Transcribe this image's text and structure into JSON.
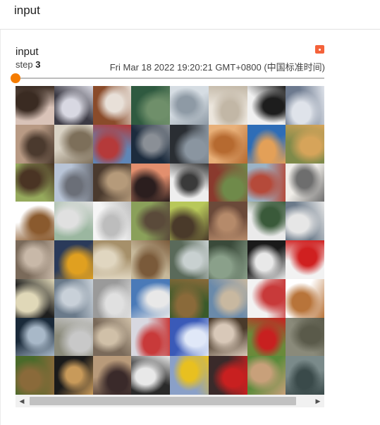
{
  "section": {
    "title": "input"
  },
  "card": {
    "title": "input",
    "step_label": "step",
    "step_value": "3",
    "timestamp": "Fri Mar 18 2022 19:20:21 GMT+0800 (中国标准时间)",
    "slider_fraction": 0.0,
    "accent_color": "#f57c00",
    "menu_icon_color": "#f4623a"
  },
  "image_grid": {
    "rows": 8,
    "cols": 8,
    "cells": [
      {
        "subject": "ship",
        "colors": [
          "#d9c3b8",
          "#3a2b22"
        ]
      },
      {
        "subject": "automobile",
        "colors": [
          "#3c3a44",
          "#d8d8e2"
        ]
      },
      {
        "subject": "horse",
        "colors": [
          "#8a4b2a",
          "#e8e0d8"
        ]
      },
      {
        "subject": "bird",
        "colors": [
          "#2f5a40",
          "#6f8f6a"
        ]
      },
      {
        "subject": "ship",
        "colors": [
          "#d6dde3",
          "#8e9aa5"
        ]
      },
      {
        "subject": "ship",
        "colors": [
          "#ebe5dc",
          "#c2b7a6"
        ]
      },
      {
        "subject": "horse",
        "colors": [
          "#f0f0f0",
          "#1d1d1d"
        ]
      },
      {
        "subject": "ship",
        "colors": [
          "#6d7a8f",
          "#dfe3ea"
        ]
      },
      {
        "subject": "dog",
        "colors": [
          "#b89a84",
          "#4b3a2e"
        ]
      },
      {
        "subject": "truck",
        "colors": [
          "#d9d2c4",
          "#7d6f5a"
        ]
      },
      {
        "subject": "ship",
        "colors": [
          "#5f86b6",
          "#b53a3a"
        ]
      },
      {
        "subject": "horse",
        "colors": [
          "#1c2b3d",
          "#8a8f96"
        ]
      },
      {
        "subject": "automobile",
        "colors": [
          "#2a2e33",
          "#8a95a0"
        ]
      },
      {
        "subject": "cat",
        "colors": [
          "#e8b079",
          "#b66a30"
        ]
      },
      {
        "subject": "frog",
        "colors": [
          "#2e6db7",
          "#e3a058"
        ]
      },
      {
        "subject": "dog",
        "colors": [
          "#7f8a4a",
          "#d6a45a"
        ]
      },
      {
        "subject": "horse",
        "colors": [
          "#96aa5d",
          "#4a3424"
        ]
      },
      {
        "subject": "truck",
        "colors": [
          "#b8c4d6",
          "#6b6f78"
        ]
      },
      {
        "subject": "horse",
        "colors": [
          "#4a3a2e",
          "#b59a7a"
        ]
      },
      {
        "subject": "deer",
        "colors": [
          "#e28f6e",
          "#2b1e1e"
        ]
      },
      {
        "subject": "dog",
        "colors": [
          "#eeeeee",
          "#3a3a3a"
        ]
      },
      {
        "subject": "truck",
        "colors": [
          "#8a3a2e",
          "#6f8a4a"
        ]
      },
      {
        "subject": "ship",
        "colors": [
          "#9bb3c6",
          "#b54a3a"
        ]
      },
      {
        "subject": "airplane",
        "colors": [
          "#f0ede8",
          "#6e6e6e"
        ]
      },
      {
        "subject": "horse",
        "colors": [
          "#ffffff",
          "#8a5a2e"
        ]
      },
      {
        "subject": "truck",
        "colors": [
          "#9bb7a0",
          "#e0e0e0"
        ]
      },
      {
        "subject": "ship",
        "colors": [
          "#f5f5f5",
          "#bdbdbd"
        ]
      },
      {
        "subject": "bird",
        "colors": [
          "#8aa05a",
          "#5a4a3a"
        ]
      },
      {
        "subject": "horse",
        "colors": [
          "#b8c85a",
          "#4a3a2a"
        ]
      },
      {
        "subject": "frog",
        "colors": [
          "#6b4a3a",
          "#b58a6a"
        ]
      },
      {
        "subject": "truck",
        "colors": [
          "#eaeaea",
          "#3a5a3a"
        ]
      },
      {
        "subject": "horse",
        "colors": [
          "#6b7a8a",
          "#e6e6e6"
        ]
      },
      {
        "subject": "cat",
        "colors": [
          "#7a6a5a",
          "#c8b8a8"
        ]
      },
      {
        "subject": "truck",
        "colors": [
          "#2a3a5a",
          "#e0a020"
        ]
      },
      {
        "subject": "dog",
        "colors": [
          "#a6906a",
          "#e0d6c0"
        ]
      },
      {
        "subject": "deer",
        "colors": [
          "#c6b89a",
          "#7a5a3a"
        ]
      },
      {
        "subject": "horse",
        "colors": [
          "#5a6a5a",
          "#c8d0d0"
        ]
      },
      {
        "subject": "frog",
        "colors": [
          "#3a4a3a",
          "#8aa08a"
        ]
      },
      {
        "subject": "dog",
        "colors": [
          "#1a1a1a",
          "#e8e8e8"
        ]
      },
      {
        "subject": "automobile",
        "colors": [
          "#f2f2f2",
          "#d02020"
        ]
      },
      {
        "subject": "dog",
        "colors": [
          "#1e1e1e",
          "#e0d8b8"
        ]
      },
      {
        "subject": "ship",
        "colors": [
          "#6a7a8a",
          "#c8d0d8"
        ]
      },
      {
        "subject": "ship",
        "colors": [
          "#9a9a9a",
          "#e0e0e0"
        ]
      },
      {
        "subject": "airplane",
        "colors": [
          "#4a7ab8",
          "#e8e8e8"
        ]
      },
      {
        "subject": "deer",
        "colors": [
          "#3a5a2a",
          "#8a6a3a"
        ]
      },
      {
        "subject": "ship",
        "colors": [
          "#6a8aaa",
          "#c8b8a0"
        ]
      },
      {
        "subject": "dog",
        "colors": [
          "#f2f2f2",
          "#c83a3a"
        ]
      },
      {
        "subject": "dog",
        "colors": [
          "#ffffff",
          "#b8743a"
        ]
      },
      {
        "subject": "automobile",
        "colors": [
          "#1a2a3a",
          "#a8b8c8"
        ]
      },
      {
        "subject": "automobile",
        "colors": [
          "#8a8a7a",
          "#c8c8c8"
        ]
      },
      {
        "subject": "ship",
        "colors": [
          "#7a6a5a",
          "#d0c0a8"
        ]
      },
      {
        "subject": "truck",
        "colors": [
          "#d8d8e0",
          "#c83a3a"
        ]
      },
      {
        "subject": "airplane",
        "colors": [
          "#3a5ab8",
          "#e0e8f8"
        ]
      },
      {
        "subject": "cat",
        "colors": [
          "#4a3a2a",
          "#d8c8b8"
        ]
      },
      {
        "subject": "automobile",
        "colors": [
          "#6a8a3a",
          "#c82020"
        ]
      },
      {
        "subject": "truck",
        "colors": [
          "#8a8a7a",
          "#5a5a4a"
        ]
      },
      {
        "subject": "bird",
        "colors": [
          "#4a6a2a",
          "#8a6a3a"
        ]
      },
      {
        "subject": "bird",
        "colors": [
          "#1a1a1a",
          "#c89a5a"
        ]
      },
      {
        "subject": "dog",
        "colors": [
          "#b89a7a",
          "#3a2a2a"
        ]
      },
      {
        "subject": "cat",
        "colors": [
          "#2a2a2a",
          "#e8e8e8"
        ]
      },
      {
        "subject": "truck",
        "colors": [
          "#8aa0c8",
          "#e8c020"
        ]
      },
      {
        "subject": "truck",
        "colors": [
          "#3a2a2a",
          "#c82020"
        ]
      },
      {
        "subject": "dog",
        "colors": [
          "#5a8a3a",
          "#c8a07a"
        ]
      },
      {
        "subject": "frog",
        "colors": [
          "#7a8a8a",
          "#3a4a4a"
        ]
      }
    ]
  },
  "scrollbar": {
    "left_icon": "chevron-left-icon",
    "right_icon": "chevron-right-icon",
    "left_glyph": "◀",
    "right_glyph": "▶"
  }
}
